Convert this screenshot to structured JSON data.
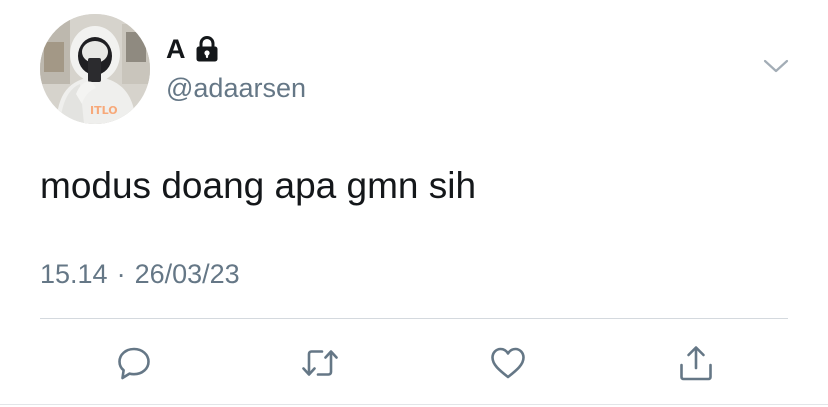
{
  "tweet": {
    "display_name": "A",
    "handle": "@adaarsen",
    "text": "modus doang apa gmn sih",
    "time": "15.14",
    "separator": "·",
    "date": "26/03/23",
    "protected": true
  },
  "icons": {
    "lock": "lock-icon",
    "more": "chevron-down-icon",
    "reply": "reply-icon",
    "retweet": "retweet-icon",
    "like": "heart-icon",
    "share": "share-icon"
  },
  "colors": {
    "text_primary": "#14171a",
    "text_secondary": "#657786",
    "icon_gray": "#657786",
    "divider": "#d4d9de"
  }
}
